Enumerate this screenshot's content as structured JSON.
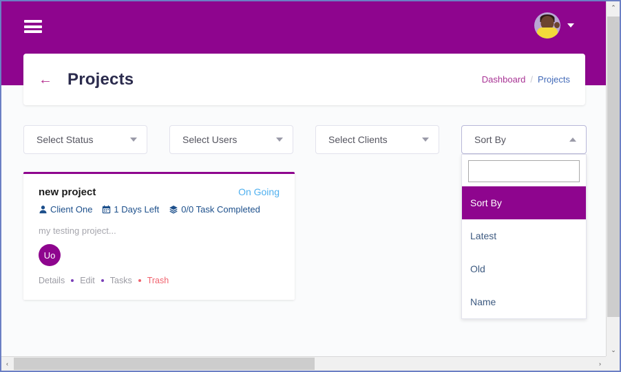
{
  "topbar": {
    "menu_icon": "hamburger-icon",
    "avatar_caret": "chevron-down-icon"
  },
  "titlecard": {
    "back_arrow": "←",
    "title": "Projects",
    "breadcrumb": {
      "parent": "Dashboard",
      "separator": "/",
      "current": "Projects"
    }
  },
  "filters": [
    {
      "name": "select-status",
      "label": "Select Status",
      "state": "closed"
    },
    {
      "name": "select-users",
      "label": "Select Users",
      "state": "closed"
    },
    {
      "name": "select-clients",
      "label": "Select Clients",
      "state": "closed"
    },
    {
      "name": "sort-by",
      "label": "Sort By",
      "state": "open"
    }
  ],
  "sort_dropdown": {
    "search_value": "",
    "search_placeholder": "",
    "options": [
      {
        "label": "Sort By",
        "selected": true
      },
      {
        "label": "Latest",
        "selected": false
      },
      {
        "label": "Old",
        "selected": false
      },
      {
        "label": "Name",
        "selected": false
      }
    ]
  },
  "project_card": {
    "name": "new project",
    "status": "On Going",
    "client": "Client One",
    "days_left": "1 Days Left",
    "tasks": "0/0 Task Completed",
    "description": "my testing project...",
    "member_initials": "Uo",
    "actions": [
      {
        "label": "Details",
        "style": "normal"
      },
      {
        "label": "Edit",
        "style": "normal"
      },
      {
        "label": "Tasks",
        "style": "normal"
      },
      {
        "label": "Trash",
        "style": "danger"
      }
    ]
  },
  "colors": {
    "brand_purple": "#8e058e",
    "status_blue": "#4fb0ef",
    "meta_blue": "#1c4f8b",
    "danger_red": "#f0616d",
    "page_bg": "#fafbfc"
  },
  "scrollbars": {
    "vertical_up": "⌃",
    "vertical_down": "⌄",
    "horizontal_left": "‹",
    "horizontal_right": "›"
  }
}
